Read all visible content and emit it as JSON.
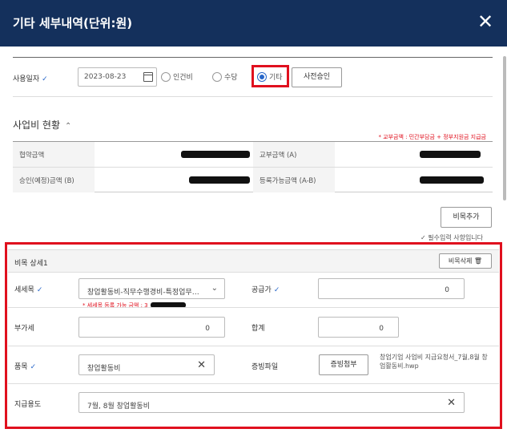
{
  "header": {
    "title": "기타 세부내역(단위:원)",
    "close_icon": "close-icon"
  },
  "usage": {
    "date_label": "사용일자",
    "date_value": "2023-08-23",
    "radio_options": [
      {
        "label": "인건비",
        "selected": false
      },
      {
        "label": "수당",
        "selected": false
      },
      {
        "label": "기타",
        "selected": true
      }
    ],
    "pre_approval_button": "사전승인"
  },
  "summary": {
    "title": "사업비 현황",
    "note": "* 교부금액 : 민간부담금 + 정부지원금 지급금",
    "labels": {
      "agreement": "협약금액",
      "grant": "교부금액 (A)",
      "approved": "승인(예정)금액 (B)",
      "available": "등록가능금액 (A-B)"
    }
  },
  "actions": {
    "add_item_button": "비목추가",
    "required_note": "✓ 필수입력 사항입니다"
  },
  "detail": {
    "title": "비목 상세1",
    "delete_button": "비목삭제",
    "sub_item_label": "세세목",
    "sub_item_value": "창업활동비-직무수행경비-특정업무…",
    "sub_item_hint": "* 세세목 등록 가능 금액 : 3",
    "supply_label": "공급가",
    "supply_value": "0",
    "vat_label": "부가세",
    "vat_value": "0",
    "total_label": "합계",
    "total_value": "0",
    "item_label": "품목",
    "item_value": "창업활동비",
    "evidence_label": "증빙파일",
    "evidence_button": "증빙첨부",
    "evidence_file": "창업기업 사업비 지급요청서_7월,8월 창업활동비.hwp",
    "purpose_label": "지급용도",
    "purpose_value": "7월, 8월 창업활동비"
  },
  "colors": {
    "header_bg": "#14305c",
    "accent": "#2766c9",
    "highlight": "#e0101e"
  }
}
